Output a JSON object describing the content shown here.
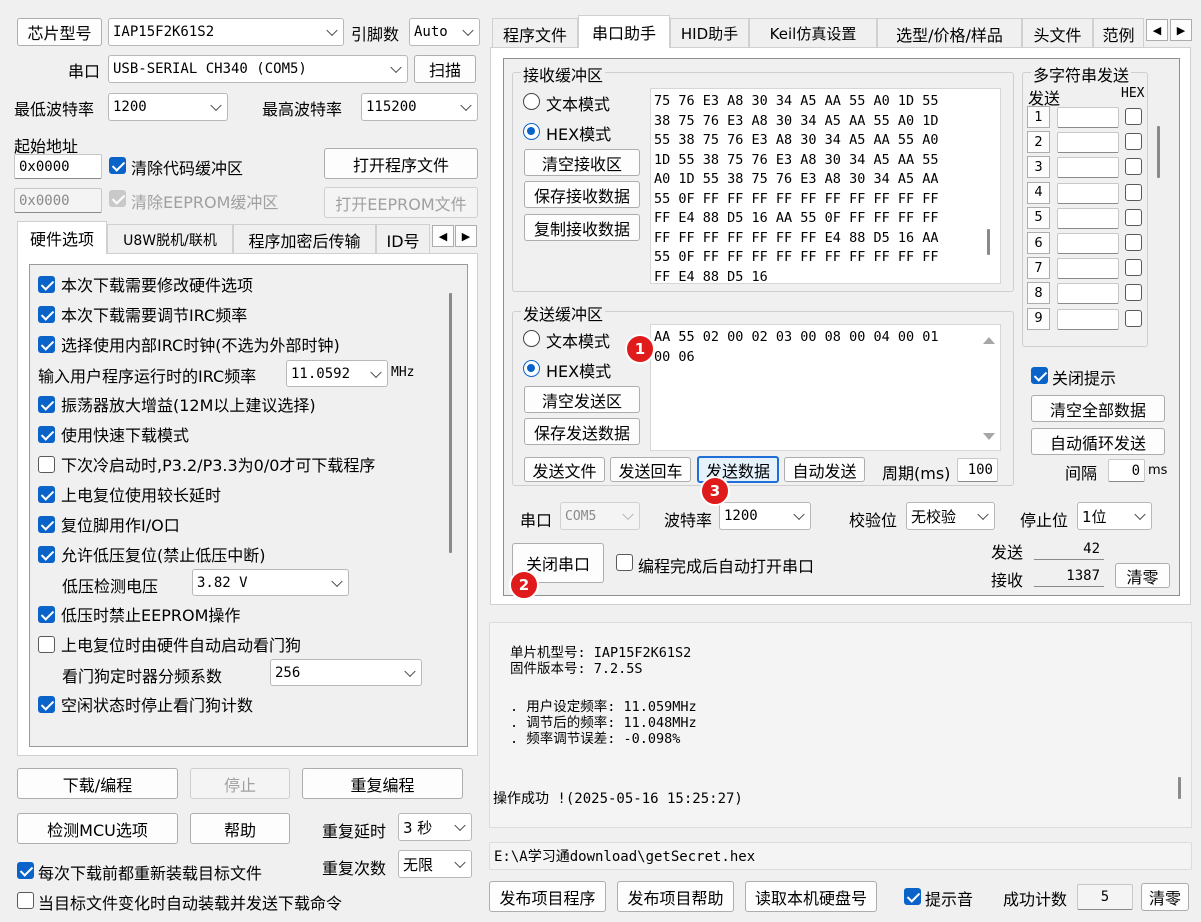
{
  "left": {
    "chip_btn": "芯片型号",
    "chip_value": "IAP15F2K61S2",
    "pins_label": "引脚数",
    "pins_value": "Auto",
    "port_label": "串口",
    "port_value": "USB-SERIAL CH340 (COM5)",
    "scan_btn": "扫描",
    "min_baud_label": "最低波特率",
    "min_baud_value": "1200",
    "max_baud_label": "最高波特率",
    "max_baud_value": "115200",
    "start_addr_label": "起始地址",
    "code_addr": "0x0000",
    "clear_code_label": "清除代码缓冲区",
    "open_prog_btn": "打开程序文件",
    "eeprom_addr": "0x0000",
    "clear_eeprom_label": "清除EEPROM缓冲区",
    "open_eeprom_btn": "打开EEPROM文件",
    "tabs": [
      "硬件选项",
      "U8W脱机/联机",
      "程序加密后传输",
      "ID号"
    ],
    "options": [
      {
        "label": "本次下载需要修改硬件选项",
        "checked": true
      },
      {
        "label": "本次下载需要调节IRC频率",
        "checked": true
      },
      {
        "label": "选择使用内部IRC时钟(不选为外部时钟)",
        "checked": true
      },
      {
        "label": "振荡器放大增益(12M以上建议选择)",
        "checked": true
      },
      {
        "label": "使用快速下载模式",
        "checked": true
      },
      {
        "label": "下次冷启动时,P3.2/P3.3为0/0才可下载程序",
        "checked": false
      },
      {
        "label": "上电复位使用较长延时",
        "checked": true
      },
      {
        "label": "复位脚用作I/O口",
        "checked": true
      },
      {
        "label": "允许低压复位(禁止低压中断)",
        "checked": true
      },
      {
        "label": "低压时禁止EEPROM操作",
        "checked": true
      },
      {
        "label": "上电复位时由硬件自动启动看门狗",
        "checked": false
      },
      {
        "label": "空闲状态时停止看门狗计数",
        "checked": true
      }
    ],
    "irc_label": "输入用户程序运行时的IRC频率",
    "irc_value": "11.0592",
    "irc_unit": "MHz",
    "lv_label": "低压检测电压",
    "lv_value": "3.82 V",
    "wdt_label": "看门狗定时器分频系数",
    "wdt_value": "256",
    "download_btn": "下载/编程",
    "stop_btn": "停止",
    "repeat_btn": "重复编程",
    "detect_btn": "检测MCU选项",
    "help_btn": "帮助",
    "repeat_delay_label": "重复延时",
    "repeat_delay_value": "3 秒",
    "repeat_count_label": "重复次数",
    "repeat_count_value": "无限",
    "reload_label": "每次下载前都重新装载目标文件",
    "auto_load_label": "当目标文件变化时自动装载并发送下载命令"
  },
  "right": {
    "tabs": [
      "程序文件",
      "串口助手",
      "HID助手",
      "Keil仿真设置",
      "选型/价格/样品",
      "头文件",
      "范例"
    ],
    "recv_group": "接收缓冲区",
    "text_mode": "文本模式",
    "hex_mode": "HEX模式",
    "clear_recv_btn": "清空接收区",
    "save_recv_btn": "保存接收数据",
    "copy_recv_btn": "复制接收数据",
    "recv_lines": [
      "75 76 E3 A8 30 34 A5 AA 55 A0 1D 55",
      "38 75 76 E3 A8 30 34 A5 AA 55 A0 1D",
      "55 38 75 76 E3 A8 30 34 A5 AA 55 A0",
      "1D 55 38 75 76 E3 A8 30 34 A5 AA 55",
      "A0 1D 55 38 75 76 E3 A8 30 34 A5 AA",
      "55 0F FF FF FF FF FF FF FF FF FF FF",
      "FF E4 88 D5 16 AA 55 0F FF FF FF FF",
      "FF FF FF FF FF FF FF E4 88 D5 16 AA",
      "55 0F FF FF FF FF FF FF FF FF FF FF",
      "FF E4 88 D5 16"
    ],
    "send_group": "发送缓冲区",
    "clear_send_btn": "清空发送区",
    "save_send_btn": "保存发送数据",
    "send_lines": [
      "AA 55 02 00 02 03 00 08 00 04 00 01",
      "00 06"
    ],
    "send_file_btn": "发送文件",
    "send_echo_btn": "发送回车",
    "send_data_btn": "发送数据",
    "auto_send_btn": "自动发送",
    "period_label": "周期(ms)",
    "period_value": "100",
    "multi_group": "多字符串发送",
    "send_col": "发送",
    "hex_col": "HEX",
    "multi_rows": [
      "1",
      "2",
      "3",
      "4",
      "5",
      "6",
      "7",
      "8",
      "9"
    ],
    "close_tip_label": "关闭提示",
    "clear_all_btn": "清空全部数据",
    "auto_loop_btn": "自动循环发送",
    "interval_label": "间隔",
    "interval_value": "0",
    "interval_unit": "ms",
    "port_label": "串口",
    "port_value": "COM5",
    "baud_label": "波特率",
    "baud_value": "1200",
    "parity_label": "校验位",
    "parity_value": "无校验",
    "stop_label": "停止位",
    "stop_value": "1位",
    "close_port_btn": "关闭串口",
    "auto_open_label": "编程完成后自动打开串口",
    "sent_label": "发送",
    "sent_value": "42",
    "recv_label": "接收",
    "recv_value": "1387",
    "clear_count_btn": "清零"
  },
  "log": {
    "lines": [
      "单片机型号: IAP15F2K61S2",
      "固件版本号: 7.2.5S",
      "",
      ". 用户设定频率: 11.059MHz",
      ". 调节后的频率: 11.048MHz",
      ". 频率调节误差: -0.098%"
    ],
    "success": "操作成功 !(2025-05-16 15:25:27)",
    "path": "E:\\A学习通download\\getSecret.hex"
  },
  "bottom": {
    "publish_btn": "发布项目程序",
    "publish_help_btn": "发布项目帮助",
    "read_disk_btn": "读取本机硬盘号",
    "sound_label": "提示音",
    "success_count_label": "成功计数",
    "success_count_value": "5",
    "clear_btn": "清零"
  },
  "markers": [
    "1",
    "2",
    "3"
  ],
  "colors": {
    "accent": "#0a63c9",
    "marker": "#e01b1b"
  }
}
